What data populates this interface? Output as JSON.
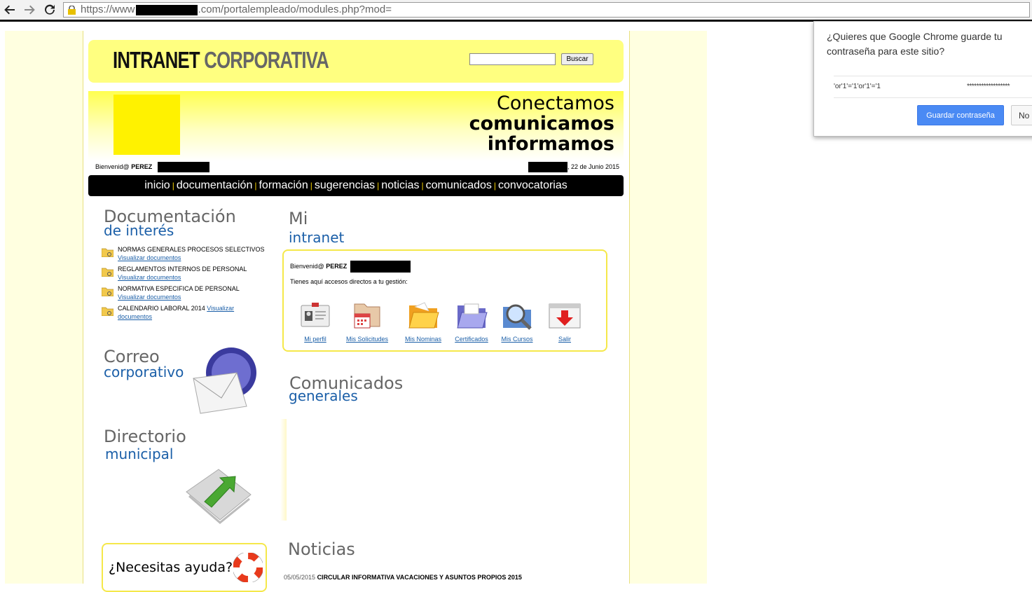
{
  "browser": {
    "back_icon": "back-arrow-icon",
    "forward_icon": "forward-arrow-icon",
    "reload_icon": "reload-icon",
    "url_prefix": "https://www",
    "url_suffix": ".com/portalempleado/modules.php?mod="
  },
  "header": {
    "logo_part1": "INTRANET",
    "logo_part2": "CORPORATIVA",
    "search_value": "",
    "search_button": "Buscar"
  },
  "banner": {
    "line1": "Conectamos",
    "line2": "comunicamos",
    "line3": "informamos",
    "welcome_prefix": "Bienvenid@",
    "welcome_name": "PEREZ",
    "date_text": ", 22 de Junio 2015"
  },
  "nav": {
    "items": [
      "inicio",
      "documentación",
      "formación",
      "sugerencias",
      "noticias",
      "comunicados",
      "convocatorias"
    ],
    "separator": "|"
  },
  "documentacion": {
    "title": "Documentación",
    "subtitle": "de interés",
    "items": [
      {
        "label": "NORMAS GENERALES PROCESOS SELECTIVOS",
        "link": "Visualizar documentos"
      },
      {
        "label": "REGLAMENTOS INTERNOS DE PERSONAL",
        "link": "Visualizar documentos"
      },
      {
        "label": "NORMATIVA ESPECIFICA DE PERSONAL",
        "link": "Visualizar documentos"
      },
      {
        "label": "CALENDARIO LABORAL 2014",
        "link": "Visualizar documentos"
      }
    ]
  },
  "correo": {
    "title": "Correo",
    "subtitle": "corporativo"
  },
  "directorio": {
    "title": "Directorio",
    "subtitle": "municipal"
  },
  "ayuda": {
    "text": "¿Necesitas ayuda?"
  },
  "mi_intranet": {
    "title": "Mi",
    "subtitle": "intranet",
    "welcome_prefix": "Bienvenid@",
    "welcome_name": "PEREZ",
    "intro": "Tienes aquí accesos directos a tu gestión:",
    "shortcuts": [
      {
        "label": "Mi perfil",
        "icon": "id-card-icon"
      },
      {
        "label": "Mis Solicitudes",
        "icon": "calendar-folder-icon"
      },
      {
        "label": "Mis Nominas",
        "icon": "folder-open-icon"
      },
      {
        "label": "Certificados",
        "icon": "folder-purple-icon"
      },
      {
        "label": "Mis Cursos",
        "icon": "magnifier-icon"
      },
      {
        "label": "Salir",
        "icon": "exit-arrow-icon"
      }
    ]
  },
  "comunicados": {
    "title": "Comunicados",
    "subtitle": "generales"
  },
  "noticias": {
    "title": "Noticias",
    "items": [
      {
        "date": "05/05/2015",
        "title": "CIRCULAR INFORMATIVA VACACIONES Y ASUNTOS PROPIOS 2015"
      }
    ]
  },
  "password_prompt": {
    "question": "¿Quieres que Google Chrome guarde tu contraseña para este sitio?",
    "username": "'or'1'='1'or'1'='1",
    "password_mask": "******************",
    "save_button": "Guardar contraseña",
    "no_button": "No"
  },
  "colors": {
    "accent_yellow": "#ffff80",
    "link_blue": "#1b5fa8",
    "nav_bg": "#000000",
    "chrome_blue": "#4a8af4"
  }
}
